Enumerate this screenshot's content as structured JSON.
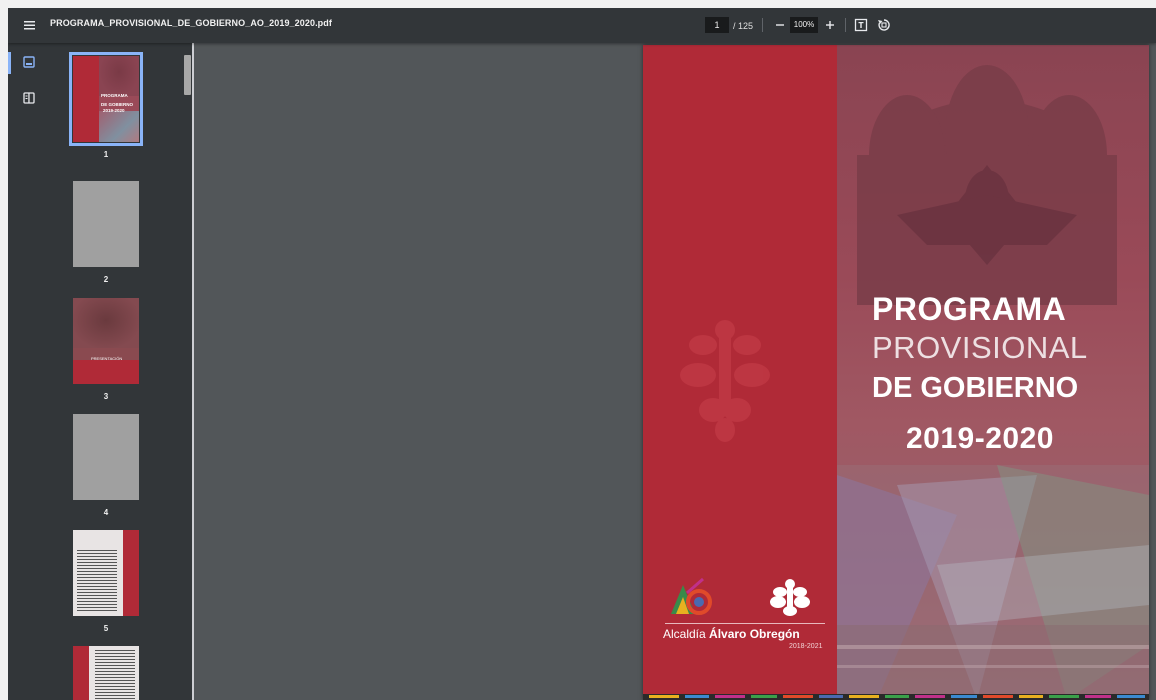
{
  "toolbar": {
    "title": "PROGRAMA_PROVISIONAL_DE_GOBIERNO_AO_2019_2020.pdf",
    "page_current": "1",
    "page_total": "/ 125",
    "zoom": "100%"
  },
  "icons": {
    "menu": "hamburger-menu-icon",
    "zoom_out": "minus-icon",
    "zoom_in": "plus-icon",
    "fit": "fit-to-page-icon",
    "rotate": "rotate-icon",
    "thumbnails": "thumbnails-icon",
    "outline": "document-outline-icon"
  },
  "thumbnails": [
    {
      "number": "1",
      "selected": true,
      "lines": [
        "PROGRAMA",
        "DE GOBIERNO",
        "2019-2020"
      ]
    },
    {
      "number": "2",
      "selected": false
    },
    {
      "number": "3",
      "selected": false,
      "caption": "PRESENTACIÓN"
    },
    {
      "number": "4",
      "selected": false
    },
    {
      "number": "5",
      "selected": false
    },
    {
      "number": "",
      "selected": false
    }
  ],
  "cover": {
    "line1": "PROGRAMA",
    "line2": "PROVISIONAL",
    "line3": "DE GOBIERNO",
    "years": "2019-2020",
    "logo_prefix": "Alcaldía ",
    "logo_name": "Álvaro Obregón",
    "logo_period": "2018-2021"
  },
  "colors": {
    "toolbar_bg": "#323639",
    "viewer_bg": "#525659",
    "accent": "#8ab4f8",
    "cover_red": "#b02a37",
    "cover_photo": "#9a4a58"
  }
}
